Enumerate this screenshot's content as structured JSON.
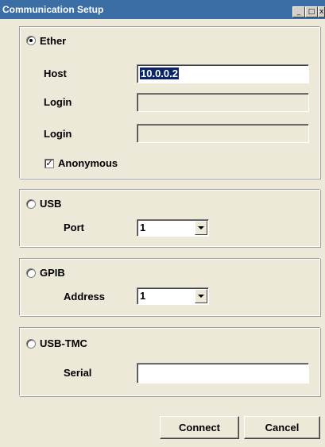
{
  "window": {
    "title": "Communication Setup",
    "min_icon": "_",
    "max_icon": "□",
    "close_icon": "x"
  },
  "ether": {
    "label": "Ether",
    "selected": true,
    "host_label": "Host",
    "host_value": "10.0.0.2",
    "login_label_1": "Login",
    "login_value_1": "",
    "login_label_2": "Login",
    "login_value_2": "",
    "anonymous_label": "Anonymous",
    "anonymous_checked": true,
    "check_mark": "✓"
  },
  "usb": {
    "label": "USB",
    "selected": false,
    "port_label": "Port",
    "port_value": "1"
  },
  "gpib": {
    "label": "GPIB",
    "selected": false,
    "address_label": "Address",
    "address_value": "1"
  },
  "usbtmc": {
    "label": "USB-TMC",
    "selected": false,
    "serial_label": "Serial",
    "serial_value": ""
  },
  "buttons": {
    "connect": "Connect",
    "cancel": "Cancel"
  }
}
